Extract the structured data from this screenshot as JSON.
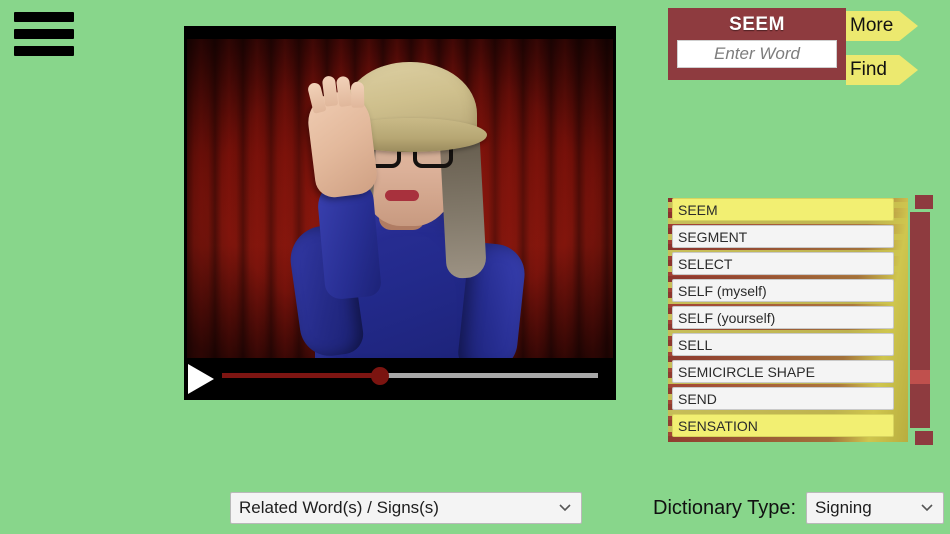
{
  "theme": {
    "background_green": "#88d68b",
    "panel_maroon": "#8e3b3f",
    "accent_yellow": "#ece96f",
    "highlight_yellow": "#f2ef72",
    "scrollbar_thumb": "#c0504d",
    "item_white": "#f4f4f4"
  },
  "menu": {
    "icon": "hamburger-menu-icon",
    "bars": 3
  },
  "search": {
    "title": "SEEM",
    "input_value": "",
    "placeholder": "Enter Word",
    "more_label": "More",
    "find_label": "Find"
  },
  "video": {
    "play_icon": "play-triangle-icon",
    "progress_percent": 42,
    "scene_description": "Woman in straw hat and glasses signing in front of red curtain"
  },
  "word_list": {
    "items": [
      {
        "label": "SEEM",
        "highlighted": true
      },
      {
        "label": "SEGMENT",
        "highlighted": false
      },
      {
        "label": "SELECT",
        "highlighted": false
      },
      {
        "label": "SELF (myself)",
        "highlighted": false
      },
      {
        "label": "SELF (yourself)",
        "highlighted": false
      },
      {
        "label": "SELL",
        "highlighted": false
      },
      {
        "label": "SEMICIRCLE SHAPE",
        "highlighted": false
      },
      {
        "label": "SEND",
        "highlighted": false
      },
      {
        "label": "SENSATION",
        "highlighted": true
      }
    ],
    "scrollbar": {
      "up_icon": "scroll-up-button",
      "down_icon": "scroll-down-button",
      "thumb_icon": "scrollbar-thumb"
    }
  },
  "bottom": {
    "related_selected": "Related Word(s) / Signs(s)",
    "dictionary_label": "Dictionary Type:",
    "dictionary_selected": "Signing",
    "chevron_icon": "chevron-down-icon"
  }
}
